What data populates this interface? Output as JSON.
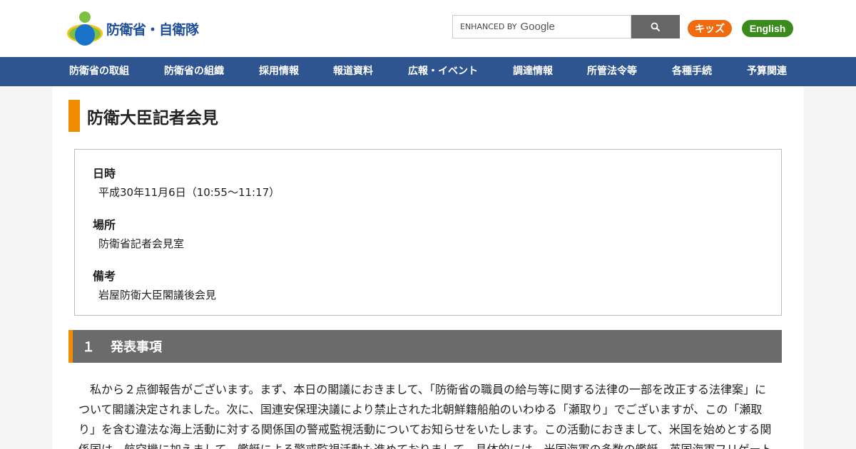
{
  "header": {
    "logo_text": "防衛省・自衛隊",
    "search": {
      "enhanced_by": "ENHANCED BY",
      "google": "Google",
      "button_icon": "search-icon"
    },
    "kids_label": "キッズ",
    "english_label": "English"
  },
  "nav": {
    "items": [
      {
        "label": "防衛省の取組"
      },
      {
        "label": "防衛省の組織"
      },
      {
        "label": "採用情報"
      },
      {
        "label": "報道資料"
      },
      {
        "label": "広報・イベント"
      },
      {
        "label": "調達情報"
      },
      {
        "label": "所管法令等"
      },
      {
        "label": "各種手続"
      },
      {
        "label": "予算関連"
      }
    ]
  },
  "page": {
    "title": "防衛大臣記者会見",
    "info": [
      {
        "label": "日時",
        "value": "平成30年11月6日（10:55～11:17）"
      },
      {
        "label": "場所",
        "value": "防衛省記者会見室"
      },
      {
        "label": "備考",
        "value": "岩屋防衛大臣閣議後会見"
      }
    ],
    "section": {
      "number": "１",
      "title": "発表事項"
    },
    "body_lines": [
      "　私から２点御報告がございます。まず、本日の閣議におきまして、「防衛省の職員の給与等に関する法律の一部を改正する法律案」に",
      "ついて閣議決定されました。次に、国連安保理決議により禁止された北朝鮮籍船舶のいわゆる「瀬取り」でございますが、この「瀬取",
      "り」を含む違法な海上活動に対する関係国の警戒監視活動についてお知らせをいたします。この活動におきまして、米国を始めとする関",
      "係国は、航空機に加えまして、艦艇による警戒監視活動も進めておりまして、具体的には、米国海軍の多数の艦艇、英国海軍フリゲート"
    ]
  },
  "colors": {
    "nav_bg": "#2e5590",
    "accent": "#f08c00",
    "kids_bg": "#f06b10",
    "english_bg": "#3a8a1c",
    "section_bg": "#6b6b6b"
  }
}
